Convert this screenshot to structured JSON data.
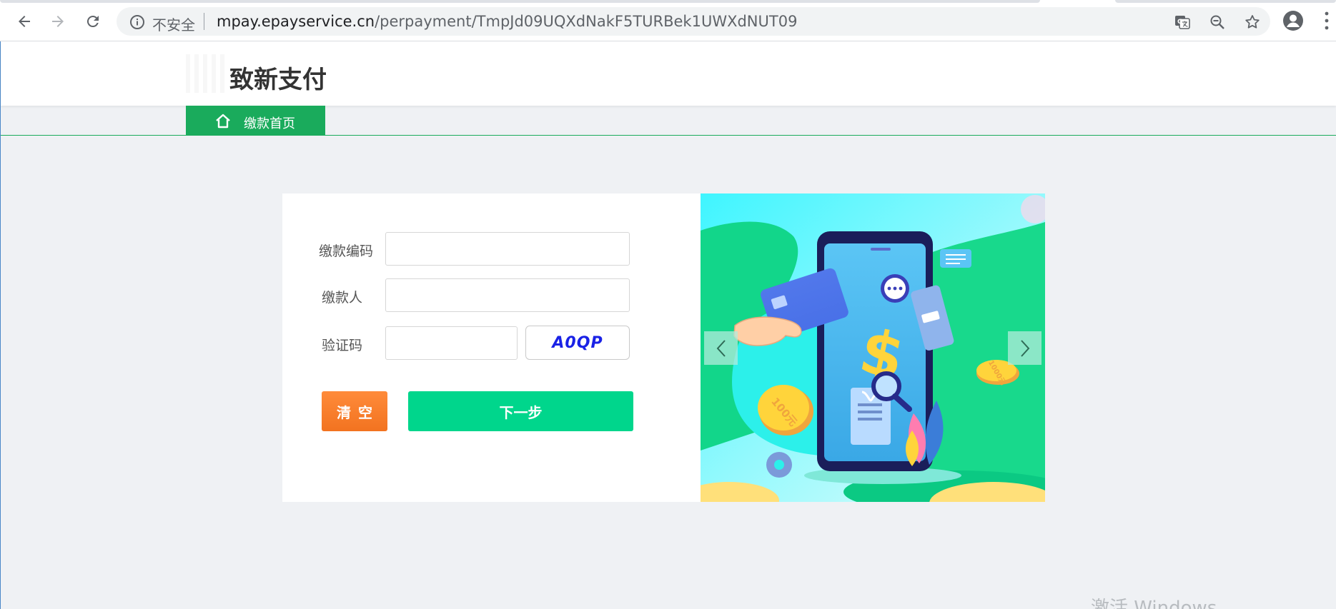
{
  "browser": {
    "security_label": "不安全",
    "url_host": "mpay.epayservice.cn",
    "url_path": "/perpayment/TmpJd09UQXdNakF5TURBek1UWXdNUT09",
    "icons": [
      "back-icon",
      "forward-icon",
      "reload-icon",
      "info-icon",
      "translate-icon",
      "zoom-out-icon",
      "star-icon",
      "profile-icon",
      "menu-icon"
    ]
  },
  "header": {
    "title": "致新支付"
  },
  "nav": {
    "home_label": "缴款首页"
  },
  "form": {
    "code_label": "缴款编码",
    "code_value": "",
    "payer_label": "缴款人",
    "payer_value": "",
    "captcha_label": "验证码",
    "captcha_value": "",
    "captcha_text": "A0QP",
    "clear_label": "清空",
    "next_label": "下一步"
  },
  "banner": {
    "coin_large_label": "100元",
    "coin_small_label": "1000元"
  },
  "watermark": "激活 Windows",
  "colors": {
    "accent_green": "#1aab5c",
    "next_button": "#00d68c",
    "clear_button": "#f27320",
    "page_bg": "#eff1f4",
    "captcha_text": "#1a22e6"
  }
}
